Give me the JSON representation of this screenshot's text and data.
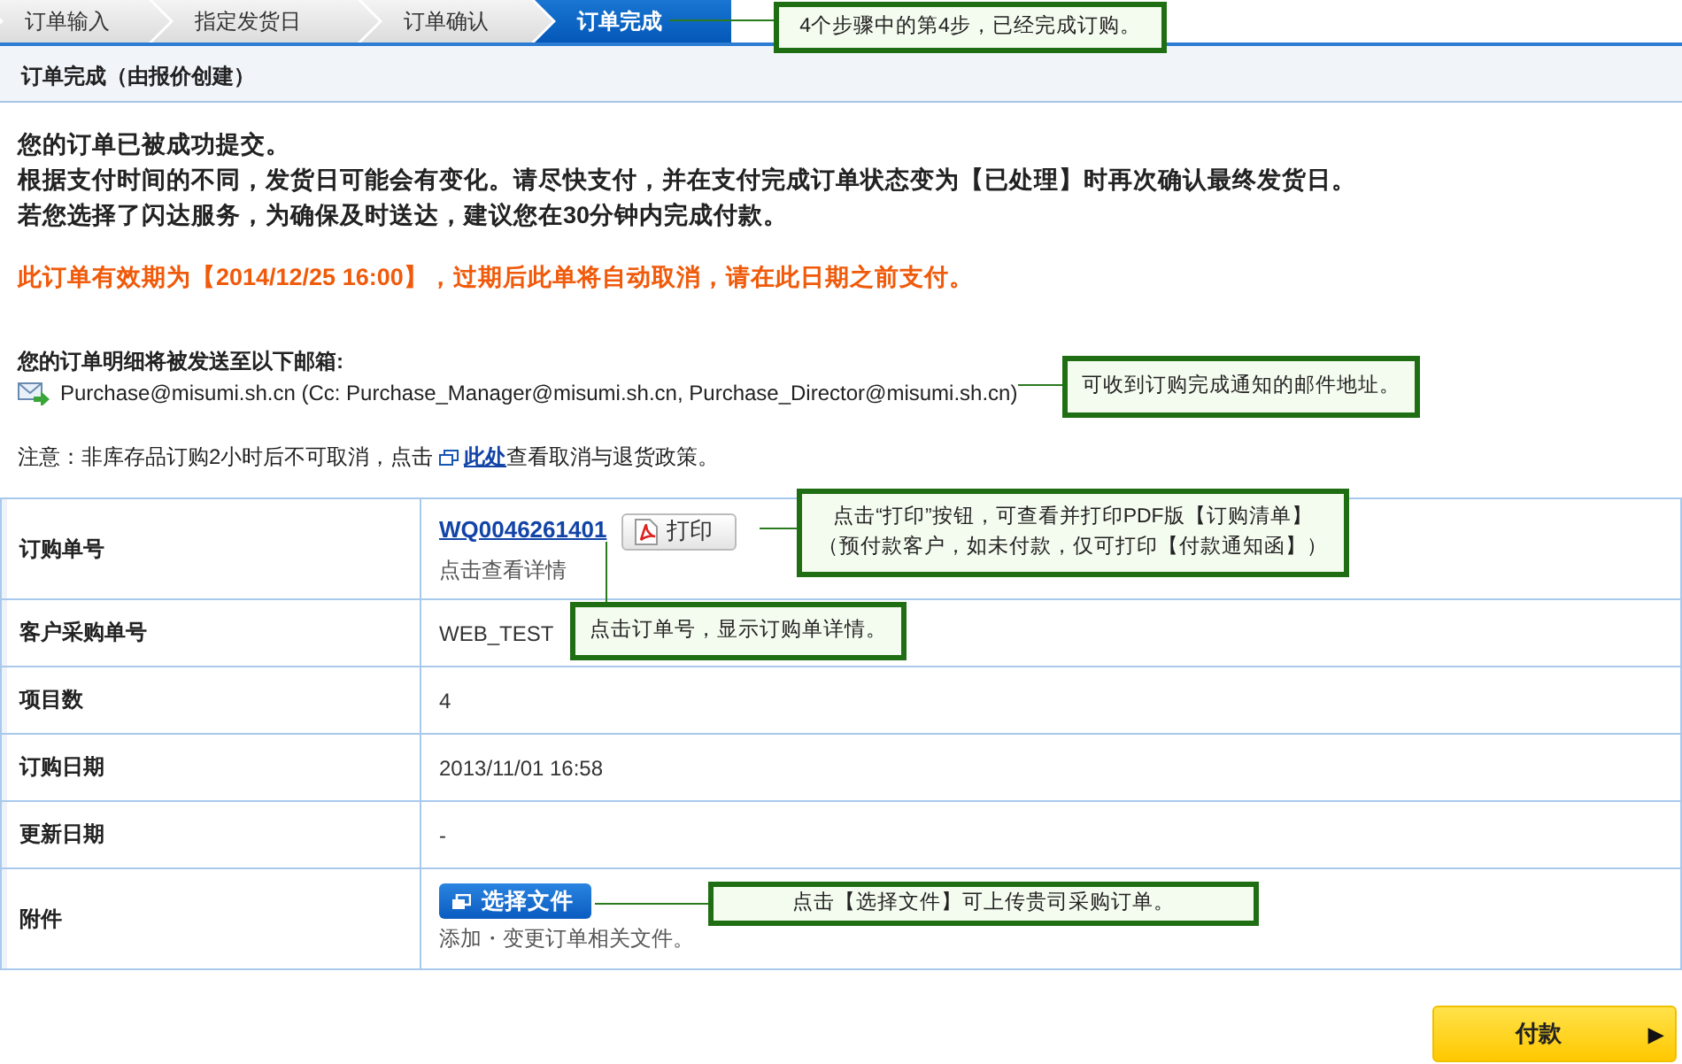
{
  "steps": [
    {
      "label": "订单输入",
      "selected": false
    },
    {
      "label": "指定发货日",
      "selected": false
    },
    {
      "label": "订单确认",
      "selected": false
    },
    {
      "label": "订单完成",
      "selected": true
    }
  ],
  "header": {
    "title": "订单完成（由报价创建）"
  },
  "messages": [
    "您的订单已被成功提交。",
    "根据支付时间的不同，发货日可能会有变化。请尽快支付，并在支付完成订单状态变为【已处理】时再次确认最终发货日。",
    "若您选择了闪达服务，为确保及时送达，建议您在30分钟内完成付款。"
  ],
  "deadline": "此订单有效期为【2014/12/25 16:00】，过期后此单将自动取消，请在此日期之前支付。",
  "email": {
    "heading": "您的订单明细将被发送至以下邮箱:",
    "addresses": "Purchase@misumi.sh.cn (Cc: Purchase_Manager@misumi.sh.cn, Purchase_Director@misumi.sh.cn)"
  },
  "notice": {
    "before": "注意：非库存品订购2小时后不可取消，点击",
    "link": "此处",
    "after": "查看取消与退货政策。"
  },
  "table": {
    "rows": [
      {
        "kind": "order",
        "label": "订购单号",
        "link": "WQ0046261401",
        "button": "打印",
        "hint": "点击查看详情"
      },
      {
        "kind": "text",
        "label": "客户采购单号",
        "value": "WEB_TEST"
      },
      {
        "kind": "text",
        "label": "项目数",
        "value": "4"
      },
      {
        "kind": "text",
        "label": "订购日期",
        "value": "2013/11/01 16:58"
      },
      {
        "kind": "text",
        "label": "更新日期",
        "value": "-"
      },
      {
        "kind": "attachment",
        "label": "附件",
        "button": "选择文件",
        "hint": "添加・变更订单相关文件。"
      }
    ]
  },
  "pay_button": {
    "label": "付款",
    "arrow": "▶"
  },
  "callouts": [
    {
      "lines": [
        "4个步骤中的第4步，已经完成订购。"
      ]
    },
    {
      "lines": [
        "可收到订购完成通知的邮件地址。"
      ]
    },
    {
      "lines": [
        "点击“打印”按钮，可查看并打印PDF版【订购清单】",
        "（预付款客户，如未付款，仅可打印【付款通知函】）"
      ]
    },
    {
      "lines": [
        "点击订单号，显示订购单详情。"
      ]
    },
    {
      "lines": [
        "点击【选择文件】可上传贵司采购订单。"
      ]
    }
  ]
}
